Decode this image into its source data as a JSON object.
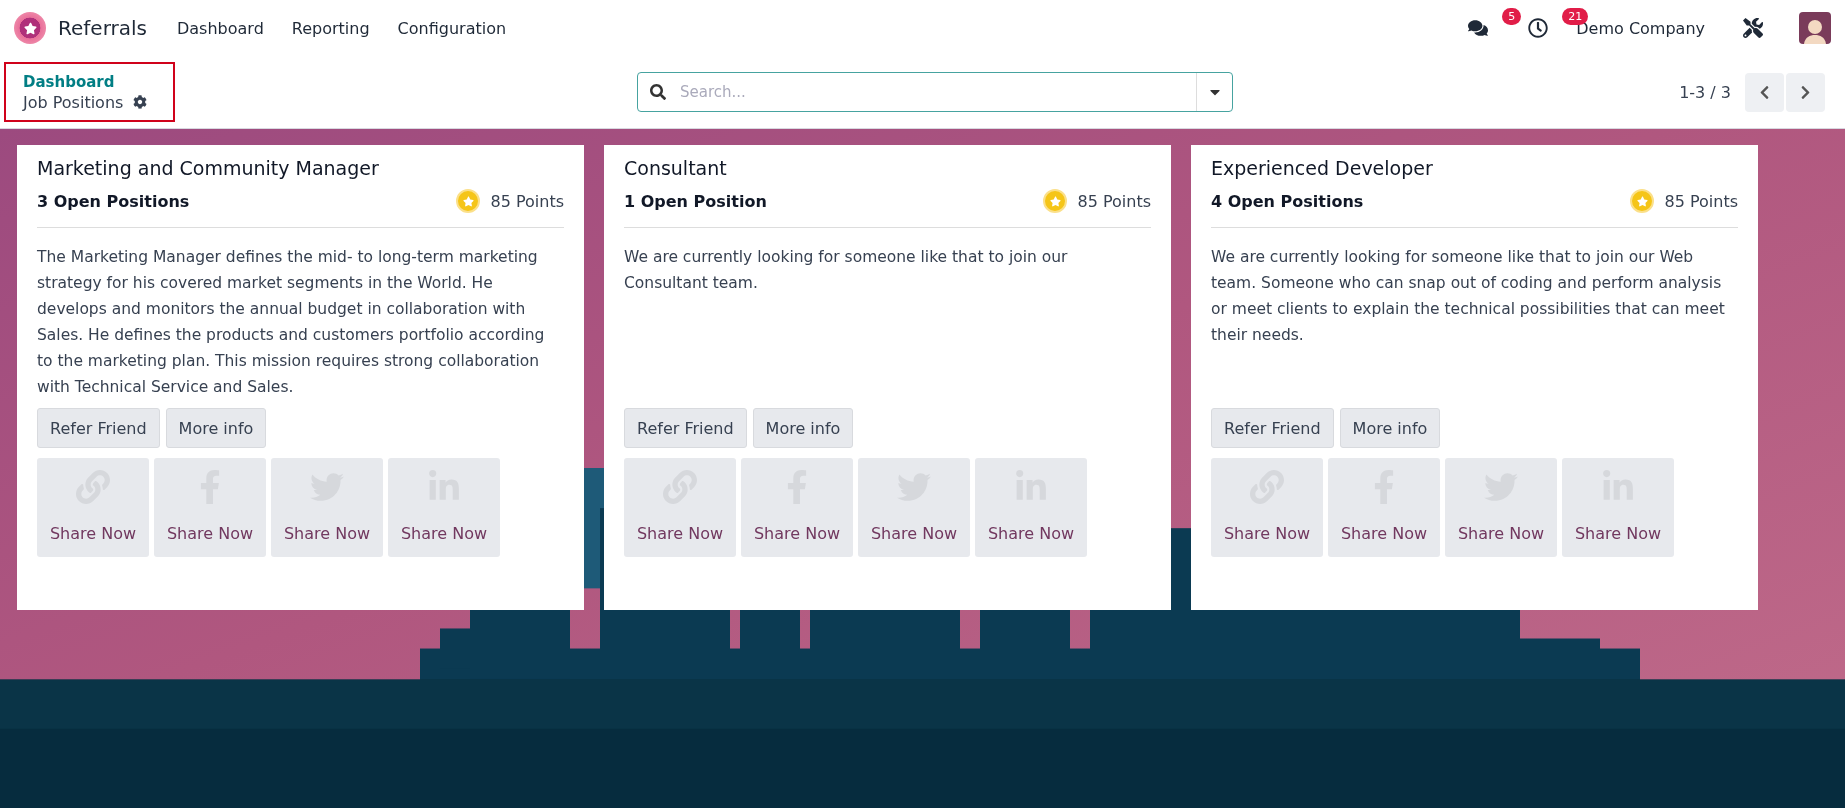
{
  "navbar": {
    "app_name": "Referrals",
    "menu": [
      "Dashboard",
      "Reporting",
      "Configuration"
    ],
    "messages_count": "5",
    "activities_count": "21",
    "company": "Demo Company"
  },
  "control_panel": {
    "breadcrumb": {
      "parent": "Dashboard",
      "current": "Job Positions",
      "highlighted": true
    },
    "search": {
      "placeholder": "Search..."
    },
    "pager": "1-3 / 3"
  },
  "jobs": [
    {
      "title": "Marketing and Community Manager",
      "open_positions": "3 Open Positions",
      "points": "85 Points",
      "description": "The Marketing Manager defines the mid- to long-term marketing strategy for his covered market segments in the World. He develops and monitors the annual budget in collaboration with Sales. He defines the products and customers portfolio according to the marketing plan. This mission requires strong collaboration with Technical Service and Sales.",
      "actions": [
        "Refer Friend",
        "More info"
      ],
      "shares": [
        {
          "kind": "link",
          "label": "Share Now"
        },
        {
          "kind": "facebook",
          "label": "Share Now"
        },
        {
          "kind": "twitter",
          "label": "Share Now"
        },
        {
          "kind": "linkedin",
          "label": "Share Now"
        }
      ]
    },
    {
      "title": "Consultant",
      "open_positions": "1 Open Position",
      "points": "85 Points",
      "description": "We are currently looking for someone like that to join our Consultant team.",
      "actions": [
        "Refer Friend",
        "More info"
      ],
      "shares": [
        {
          "kind": "link",
          "label": "Share Now"
        },
        {
          "kind": "facebook",
          "label": "Share Now"
        },
        {
          "kind": "twitter",
          "label": "Share Now"
        },
        {
          "kind": "linkedin",
          "label": "Share Now"
        }
      ]
    },
    {
      "title": "Experienced Developer",
      "open_positions": "4 Open Positions",
      "points": "85 Points",
      "description": "We are currently looking for someone like that to join our Web team. Someone who can snap out of coding and perform analysis or meet clients to explain the technical possibilities that can meet their needs.",
      "actions": [
        "Refer Friend",
        "More info"
      ],
      "shares": [
        {
          "kind": "link",
          "label": "Share Now"
        },
        {
          "kind": "facebook",
          "label": "Share Now"
        },
        {
          "kind": "twitter",
          "label": "Share Now"
        },
        {
          "kind": "linkedin",
          "label": "Share Now"
        }
      ]
    }
  ]
}
